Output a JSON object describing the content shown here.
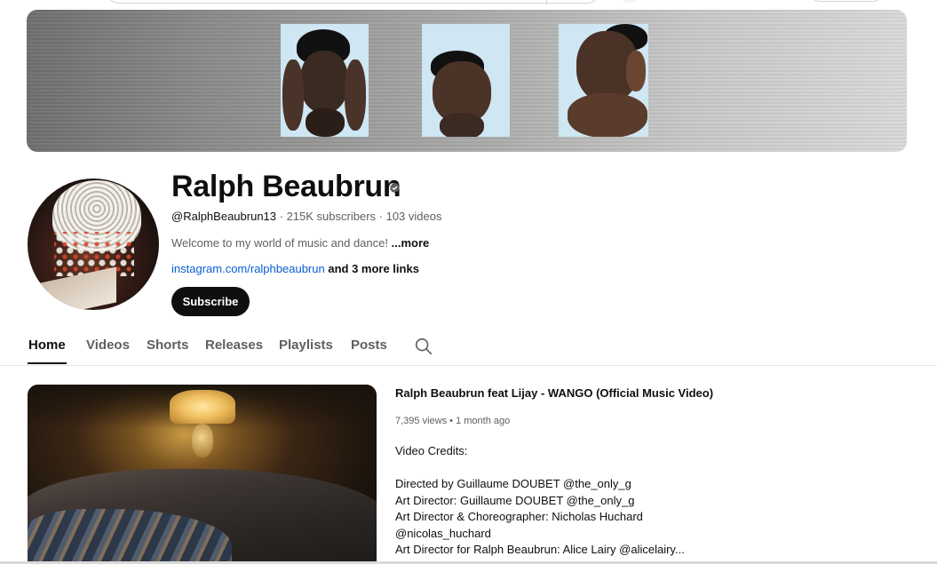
{
  "channel": {
    "name": "Ralph Beaubrun",
    "handle": "@RalphBeaubrun13",
    "subscribers": "215K subscribers",
    "videos": "103 videos",
    "separator": " · ",
    "description": "Welcome to my world of music and dance!",
    "description_more": "...more",
    "link_text": "instagram.com/ralphbeaubrun",
    "more_links": "and 3 more links",
    "subscribe_label": "Subscribe"
  },
  "tabs": [
    {
      "label": "Home",
      "active": true
    },
    {
      "label": "Videos",
      "active": false
    },
    {
      "label": "Shorts",
      "active": false
    },
    {
      "label": "Releases",
      "active": false
    },
    {
      "label": "Playlists",
      "active": false
    },
    {
      "label": "Posts",
      "active": false
    }
  ],
  "featured_video": {
    "title": "Ralph Beaubrun feat Lijay - WANGO (Official Music Video)",
    "views": "7,395 views",
    "dot": " • ",
    "age": "1 month ago",
    "description_lines": [
      "Video Credits:",
      "",
      "Directed by Guillaume DOUBET @the_only_g",
      "Art Director: Guillaume DOUBET @the_only_g",
      "Art Director & Choreographer: Nicholas Huchard",
      "@nicolas_huchard",
      "Art Director for Ralph Beaubrun: Alice Lairy @alicelairy..."
    ]
  },
  "icons": {
    "verified": "verified-badge-icon",
    "search": "search-icon"
  },
  "colors": {
    "link": "#065fd4",
    "primary_text": "#0f0f0f",
    "secondary_text": "#606060",
    "subscribe_bg": "#0f0f0f"
  }
}
